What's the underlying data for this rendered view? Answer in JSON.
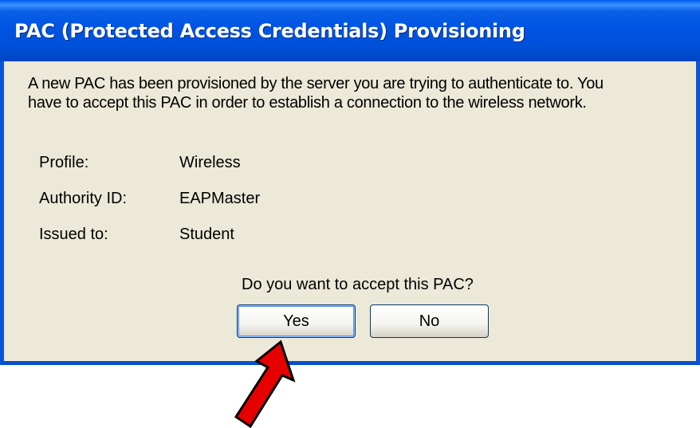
{
  "window": {
    "title": "PAC (Protected Access Credentials) Provisioning"
  },
  "message": {
    "line1": "A new PAC has been provisioned by the server you are trying to authenticate to. You",
    "line2": "have to accept this PAC in order to establish a connection to the wireless network."
  },
  "details": [
    {
      "label": "Profile:",
      "value": "Wireless"
    },
    {
      "label": "Authority ID:",
      "value": "EAPMaster"
    },
    {
      "label": "Issued to:",
      "value": "Student"
    }
  ],
  "question": "Do you want to accept this PAC?",
  "buttons": {
    "yes": "Yes",
    "no": "No"
  },
  "annotation": {
    "arrow_icon": "red-arrow-icon",
    "arrow_color": "#e60000"
  },
  "colors": {
    "titlebar": "#0054e3",
    "dialog_bg": "#ece9d8",
    "border": "#0a56d6"
  }
}
